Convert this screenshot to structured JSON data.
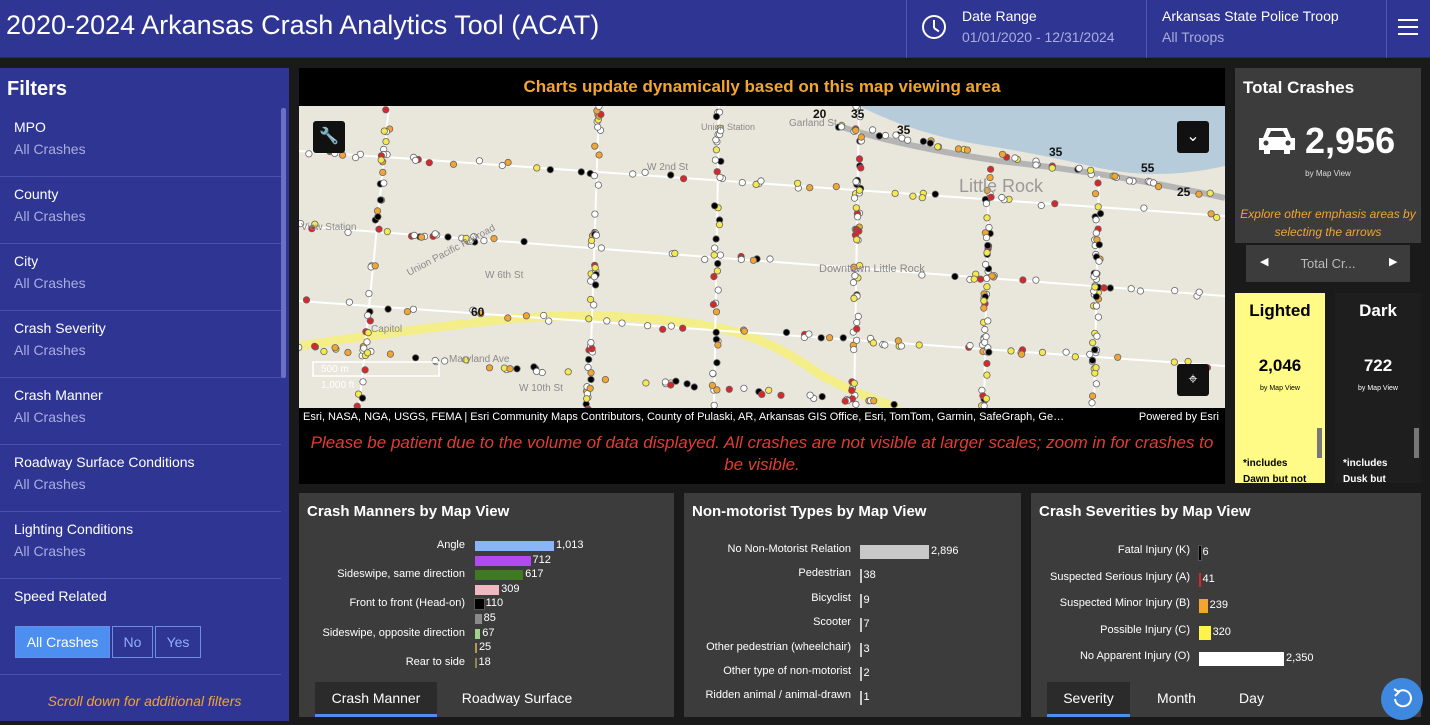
{
  "header": {
    "title": "2020-2024 Arkansas Crash Analytics Tool (ACAT)",
    "date_range_label": "Date Range",
    "date_range_value": "01/01/2020 - 12/31/2024",
    "troop_label": "Arkansas State Police Troop",
    "troop_value": "All Troops"
  },
  "sidebar": {
    "title": "Filters",
    "filters": [
      {
        "label": "MPO",
        "value": "All Crashes"
      },
      {
        "label": "County",
        "value": "All Crashes"
      },
      {
        "label": "City",
        "value": "All Crashes"
      },
      {
        "label": "Crash Severity",
        "value": "All Crashes"
      },
      {
        "label": "Crash Manner",
        "value": "All Crashes"
      },
      {
        "label": "Roadway Surface Conditions",
        "value": "All Crashes"
      },
      {
        "label": "Lighting Conditions",
        "value": "All Crashes"
      }
    ],
    "speed_label": "Speed Related",
    "speed_options": [
      "All Crashes",
      "No",
      "Yes"
    ],
    "speed_selected": "All Crashes",
    "scroll_hint": "Scroll down for additional filters"
  },
  "map": {
    "banner": "Charts update dynamically based on this map viewing area",
    "scale_m": "500 m",
    "scale_ft": "1,000 ft",
    "attribution": "Esri, NASA, NGA, USGS, FEMA | Esri Community Maps Contributors, County of Pulaski, AR, Arkansas GIS Office, Esri, TomTom, Garmin, SafeGraph, Ge…",
    "powered_by": "Powered by Esri",
    "patience_note": "Please be patient due to the volume of data displayed. All crashes are not visible at larger scales; zoom in for crashes to be visible.",
    "labels": {
      "union_station": "Union Station",
      "garland": "Garland St",
      "w2nd": "W 2nd St",
      "w6th": "W 6th St",
      "w10th": "W 10th St",
      "little_rock": "Little Rock",
      "downtown": "Downtown Little Rock",
      "maryland": "Maryland Ave",
      "union_pacific": "Union Pacific Railroad",
      "capitol": "Capitol",
      "view_station": "View Station"
    },
    "route_shields": [
      "20",
      "35",
      "35",
      "35",
      "55",
      "25",
      "60"
    ]
  },
  "total": {
    "title": "Total Crashes",
    "icon": "car-icon",
    "value": "2,956",
    "sub": "by Map View",
    "hint": "Explore other emphasis areas by selecting the arrows",
    "pager_label": "Total Cr..."
  },
  "lighting": {
    "lighted_title": "Lighted",
    "lighted_value": "2,046",
    "lighted_sub": "by Map View",
    "lighted_note1": "*includes",
    "lighted_note2": "Dawn but not",
    "dark_title": "Dark",
    "dark_value": "722",
    "dark_sub": "by Map View",
    "dark_note1": "*includes",
    "dark_note2": "Dusk but"
  },
  "colors": {
    "header": "#2e3592",
    "accent": "#4d8ff0",
    "orange": "#f2a531",
    "red": "#e53b30",
    "lighted": "#fffb86"
  },
  "chart_data": [
    {
      "type": "bar",
      "title": "Crash Manners by Map View",
      "categories": [
        "Angle",
        "",
        "Sideswipe, same direction",
        "",
        "Front to front (Head-on)",
        "",
        "Sideswipe, opposite direction",
        "",
        "Rear to side"
      ],
      "values": [
        1013,
        712,
        617,
        309,
        110,
        85,
        67,
        25,
        18
      ],
      "value_labels": [
        "1,013",
        "712",
        "617",
        "309",
        "110",
        "85",
        "67",
        "25",
        "18"
      ],
      "colors": [
        "#8ab4f8",
        "#b249f2",
        "#3f7a23",
        "#f2b8c0",
        "#000000",
        "#8a8a8a",
        "#9fd38a",
        "#b39a5a",
        "#8a8a4a"
      ],
      "xlim": [
        0,
        1013
      ]
    },
    {
      "type": "bar",
      "title": "Non-motorist Types by Map View",
      "categories": [
        "No Non-Motorist Relation",
        "Pedestrian",
        "Bicyclist",
        "Scooter",
        "Other pedestrian (wheelchair)",
        "Other type of non-motorist",
        "Ridden animal / animal-drawn"
      ],
      "values": [
        2896,
        38,
        9,
        7,
        3,
        2,
        1
      ],
      "value_labels": [
        "2,896",
        "38",
        "9",
        "7",
        "3",
        "2",
        "1"
      ],
      "colors": [
        "#c8c8c8",
        "#c8c8c8",
        "#c8c8c8",
        "#c8c8c8",
        "#c8c8c8",
        "#c8c8c8",
        "#c8c8c8"
      ],
      "xlim": [
        0,
        2896
      ]
    },
    {
      "type": "bar",
      "title": "Crash Severities by Map View",
      "categories": [
        "Fatal Injury (K)",
        "Suspected Serious Injury (A)",
        "Suspected Minor Injury (B)",
        "Possible Injury (C)",
        "No Apparent Injury (O)"
      ],
      "values": [
        6,
        41,
        239,
        320,
        2350
      ],
      "value_labels": [
        "6",
        "41",
        "239",
        "320",
        "2,350"
      ],
      "colors": [
        "#000000",
        "#d8262b",
        "#f2a531",
        "#fff24a",
        "#ffffff"
      ],
      "xlim": [
        0,
        2350
      ]
    }
  ],
  "tabs": {
    "left": [
      "Crash Manner",
      "Roadway Surface"
    ],
    "right": [
      "Severity",
      "Month",
      "Day"
    ]
  }
}
